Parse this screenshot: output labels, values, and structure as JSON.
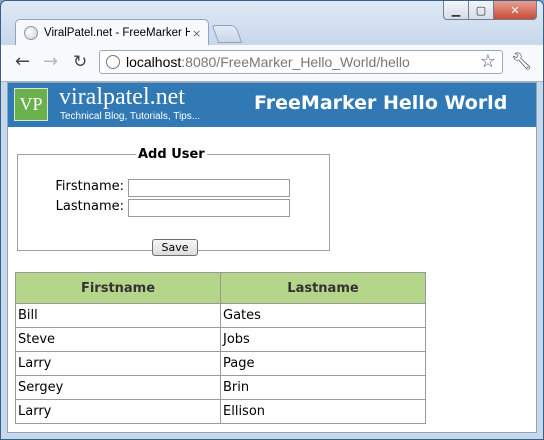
{
  "browser": {
    "tab_title": "ViralPatel.net - FreeMarker H",
    "tab_close": "×",
    "url_host": "localhost",
    "url_rest": ":8080/FreeMarker_Hello_World/hello",
    "icons": {
      "back": "back-arrow-icon",
      "forward": "forward-arrow-icon",
      "reload": "reload-icon",
      "star": "bookmark-star-icon",
      "wrench": "wrench-icon"
    }
  },
  "header": {
    "logo_text": "VP",
    "site_name": "viralpatel.net",
    "tagline": "Technical Blog, Tutorials, Tips...",
    "page_title": "FreeMarker Hello World",
    "color": "#3079b4"
  },
  "form": {
    "legend": "Add User",
    "firstname_label": "Firstname:",
    "firstname_value": "",
    "lastname_label": "Lastname:",
    "lastname_value": "",
    "save_label": "Save"
  },
  "table": {
    "headers": [
      "Firstname",
      "Lastname"
    ],
    "header_color": "#b5d58b",
    "rows": [
      [
        "Bill",
        "Gates"
      ],
      [
        "Steve",
        "Jobs"
      ],
      [
        "Larry",
        "Page"
      ],
      [
        "Sergey",
        "Brin"
      ],
      [
        "Larry",
        "Ellison"
      ]
    ]
  }
}
